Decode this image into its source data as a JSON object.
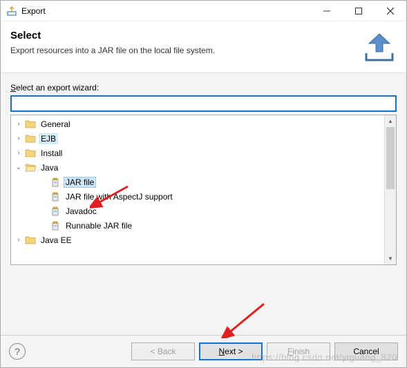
{
  "titlebar": {
    "title": "Export"
  },
  "header": {
    "title": "Select",
    "description": "Export resources into a JAR file on the local file system."
  },
  "wizard": {
    "select_label_pre": "S",
    "select_label_rest": "elect an export wizard:",
    "search_value": ""
  },
  "tree": {
    "items": [
      {
        "label": "General",
        "type": "folder",
        "expanded": false,
        "indent": 1
      },
      {
        "label": "EJB",
        "type": "folder",
        "expanded": false,
        "indent": 1,
        "highlighted": true
      },
      {
        "label": "Install",
        "type": "folder",
        "expanded": false,
        "indent": 1
      },
      {
        "label": "Java",
        "type": "folder",
        "expanded": true,
        "indent": 1
      },
      {
        "label": "JAR file",
        "type": "leaf",
        "indent": 2,
        "selected": true
      },
      {
        "label": "JAR file with AspectJ support",
        "type": "leaf",
        "indent": 2
      },
      {
        "label": "Javadoc",
        "type": "leaf",
        "indent": 2
      },
      {
        "label": "Runnable JAR file",
        "type": "leaf",
        "indent": 2
      },
      {
        "label": "Java EE",
        "type": "folder",
        "expanded": false,
        "indent": 1
      }
    ]
  },
  "buttons": {
    "back": "< Back",
    "next_ul": "N",
    "next_rest": "ext >",
    "finish_ul": "F",
    "finish_rest": "inish",
    "cancel": "Cancel"
  },
  "watermark": "https://blog.csdn.net/yiguang_820"
}
